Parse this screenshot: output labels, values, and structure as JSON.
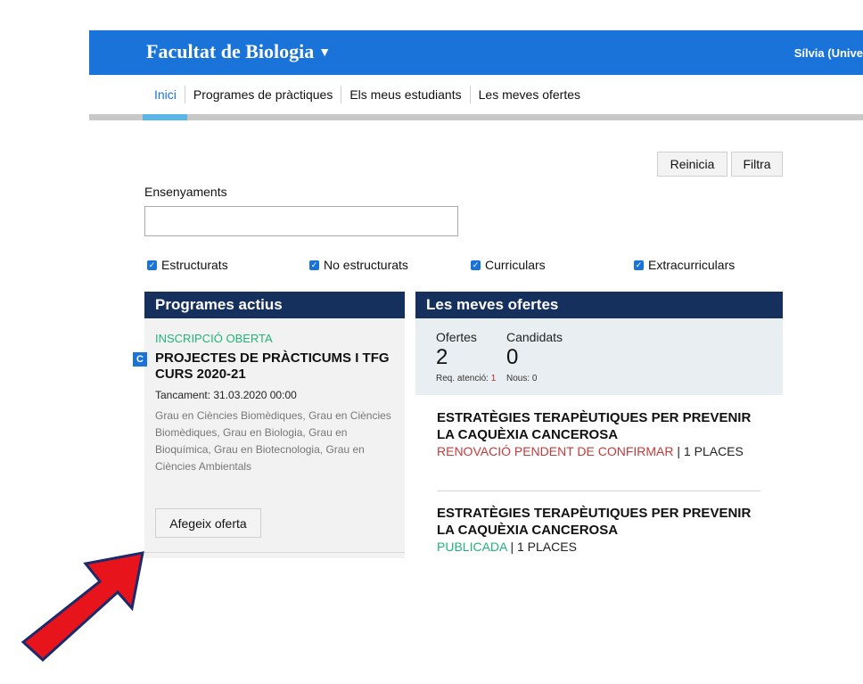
{
  "header": {
    "brand": "Facultat de Biologia",
    "brand_caret": "▼",
    "user": "Sílvia (Unive"
  },
  "nav": {
    "items": [
      {
        "label": "Inici"
      },
      {
        "label": "Programes de pràctiques"
      },
      {
        "label": "Els meus estudiants"
      },
      {
        "label": "Les meves ofertes"
      }
    ]
  },
  "filters": {
    "reset_label": "Reinicia",
    "filter_label": "Filtra",
    "ensenyaments_label": "Ensenyaments",
    "ensenyaments_value": "",
    "checkboxes": [
      {
        "label": "Estructurats",
        "checked": true
      },
      {
        "label": "No estructurats",
        "checked": true
      },
      {
        "label": "Curriculars",
        "checked": true
      },
      {
        "label": "Extracurriculars",
        "checked": true
      }
    ]
  },
  "programes": {
    "heading": "Programes actius",
    "status": "INSCRIPCIÓ OBERTA",
    "badge": "C",
    "title": "PROJECTES DE PRÀCTICUMS I TFG CURS 2020-21",
    "closing": "Tancament: 31.03.2020 00:00",
    "degrees": "Grau en Ciències Biomèdiques, Grau en Ciències Biomèdiques, Grau en Biologia, Grau en Bioquímica, Grau en Biotecnologia, Grau en Ciències Ambientals",
    "add_button": "Afegeix oferta"
  },
  "ofertes": {
    "heading": "Les meves ofertes",
    "stats": {
      "offers_label": "Ofertes",
      "offers_value": "2",
      "req_label": "Req. atenció:",
      "req_value": "1",
      "candidates_label": "Candidats",
      "candidates_value": "0",
      "new_label": "Nous: 0"
    },
    "items": [
      {
        "title": "ESTRATÈGIES TERAPÈUTIQUES PER PREVENIR LA CAQUÈXIA CANCEROSA",
        "status": "RENOVACIÓ PENDENT DE CONFIRMAR",
        "places": " | 1 PLACES"
      },
      {
        "title": "ESTRATÈGIES TERAPÈUTIQUES PER PREVENIR LA CAQUÈXIA CANCEROSA",
        "status": "PUBLICADA",
        "places": " | 1 PLACES"
      }
    ]
  },
  "colors": {
    "header_blue": "#1a73d9",
    "panel_navy": "#16305e",
    "status_green": "#22b37a",
    "status_red": "#c53a3a",
    "arrow_red": "#e8141c"
  },
  "annotation": {
    "arrow_icon": "red-arrow-icon"
  }
}
